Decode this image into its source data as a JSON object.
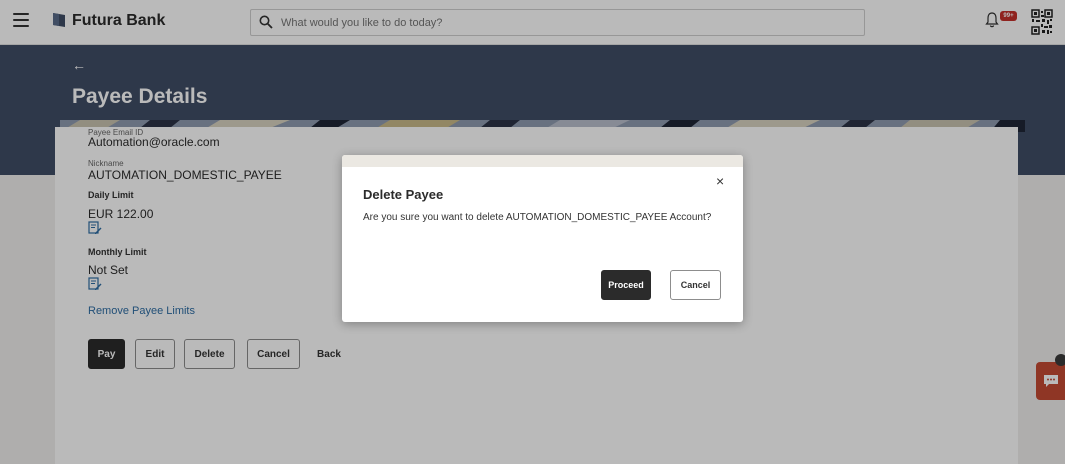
{
  "header": {
    "brand": "Futura Bank",
    "search_placeholder": "What would you like to do today?",
    "notification_badge": "99+"
  },
  "banner": {
    "back_arrow": "←",
    "title": "Payee Details"
  },
  "details": {
    "email_label": "Payee Email ID",
    "email_value": "Automation@oracle.com",
    "nickname_label": "Nickname",
    "nickname_value": "AUTOMATION_DOMESTIC_PAYEE",
    "daily_limit_label": "Daily Limit",
    "daily_limit_value": "EUR 122.00",
    "monthly_limit_label": "Monthly Limit",
    "monthly_limit_value": "Not Set",
    "remove_limits_link": "Remove Payee Limits"
  },
  "actions": {
    "pay": "Pay",
    "edit": "Edit",
    "delete": "Delete",
    "cancel": "Cancel",
    "back": "Back"
  },
  "modal": {
    "title": "Delete Payee",
    "close": "×",
    "message": "Are you sure you want to delete AUTOMATION_DOMESTIC_PAYEE Account?",
    "proceed": "Proceed",
    "cancel": "Cancel"
  },
  "colors": {
    "banner": "#3f4d66",
    "primary_button": "#2b2b2b",
    "link": "#2e6da4",
    "chat_widget": "#c44a33",
    "badge": "#c4312b"
  },
  "icons": {
    "menu": "hamburger-icon",
    "logo": "bank-logo-icon",
    "search": "search-icon",
    "notifications": "bell-icon",
    "qr": "qr-code-icon",
    "edit_limit": "edit-limit-icon",
    "chat": "chat-icon"
  }
}
